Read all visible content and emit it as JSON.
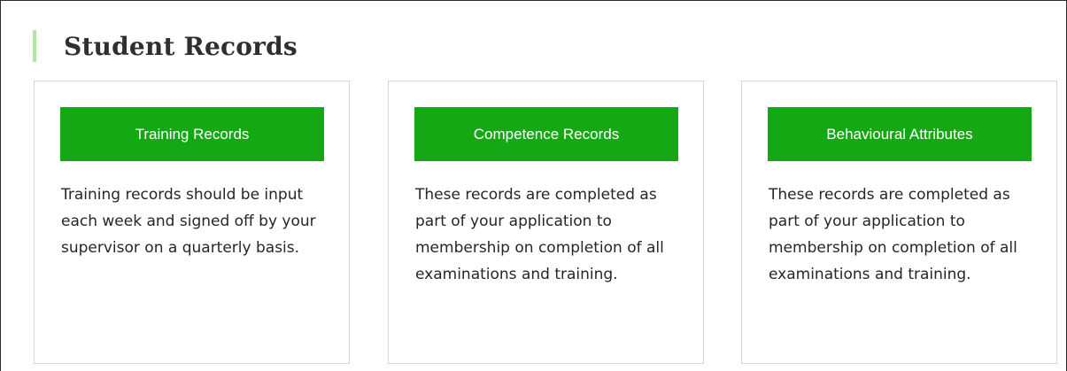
{
  "header": {
    "title": "Student Records",
    "accent_color": "#b4e3a6"
  },
  "theme": {
    "button_color": "#15a815"
  },
  "cards": [
    {
      "button_label": "Training Records",
      "description": "Training records should be input each week and signed off by your supervisor on a quarterly basis."
    },
    {
      "button_label": "Competence Records",
      "description": "These records are completed as part of your application to membership on completion of all examinations and training."
    },
    {
      "button_label": "Behavioural Attributes",
      "description": "These records are completed as part of your application to membership on completion of all examinations and training."
    }
  ]
}
